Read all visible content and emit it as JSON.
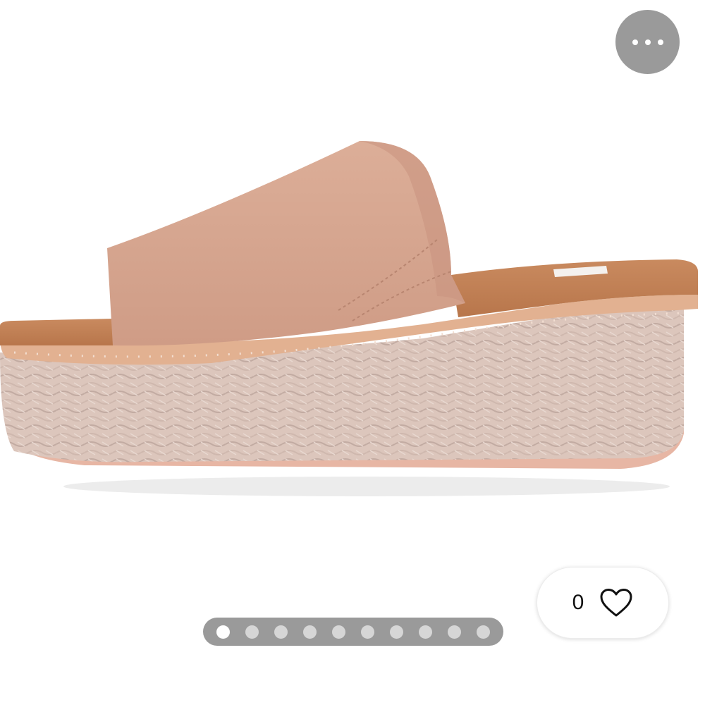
{
  "product_image": {
    "subject": "sandal-photo",
    "upper_color": "#d8a790",
    "footbed_color": "#c27f55",
    "sole_color": "#d9c3b8"
  },
  "actions": {
    "more_icon": "ellipsis-icon"
  },
  "like": {
    "count": "0",
    "icon": "heart-icon"
  },
  "gallery": {
    "total_images": 10,
    "current_index": 1
  },
  "colors": {
    "overlay_gray": "#9a9a9a",
    "dot_inactive": "#d6d6d6",
    "dot_active": "#ffffff"
  }
}
